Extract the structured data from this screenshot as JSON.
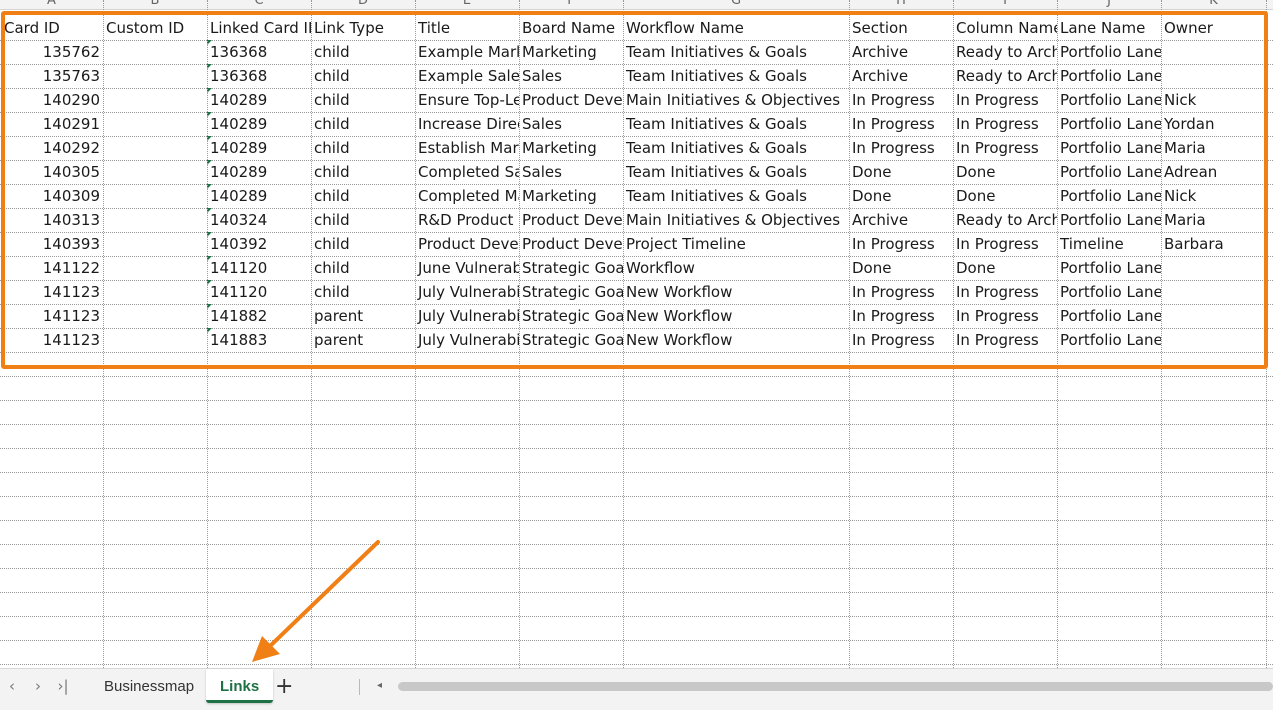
{
  "column_letters": [
    "A",
    "B",
    "C",
    "D",
    "E",
    "F",
    "G",
    "H",
    "I",
    "J",
    "K"
  ],
  "header": [
    "Card ID",
    "Custom ID",
    "Linked Card ID",
    "Link Type",
    "Title",
    "Board Name",
    "Workflow Name",
    "Section",
    "Column Name",
    "Lane Name",
    "Owner"
  ],
  "rows": [
    [
      "135762",
      "",
      "136368",
      "child",
      "Example Marketing",
      "Marketing",
      "Team Initiatives & Goals",
      "Archive",
      "Ready to Archive",
      "Portfolio Lane",
      ""
    ],
    [
      "135763",
      "",
      "136368",
      "child",
      "Example Sales",
      "Sales",
      "Team Initiatives & Goals",
      "Archive",
      "Ready to Archive",
      "Portfolio Lane",
      ""
    ],
    [
      "140290",
      "",
      "140289",
      "child",
      "Ensure Top-Level",
      "Product Development",
      "Main Initiatives & Objectives",
      "In Progress",
      "In Progress",
      "Portfolio Lane",
      "Nick"
    ],
    [
      "140291",
      "",
      "140289",
      "child",
      "Increase Direct",
      "Sales",
      "Team Initiatives & Goals",
      "In Progress",
      "In Progress",
      "Portfolio Lane",
      "Yordan"
    ],
    [
      "140292",
      "",
      "140289",
      "child",
      "Establish Market",
      "Marketing",
      "Team Initiatives & Goals",
      "In Progress",
      "In Progress",
      "Portfolio Lane",
      "Maria"
    ],
    [
      "140305",
      "",
      "140289",
      "child",
      "Completed Sales",
      "Sales",
      "Team Initiatives & Goals",
      "Done",
      "Done",
      "Portfolio Lane",
      "Adrean"
    ],
    [
      "140309",
      "",
      "140289",
      "child",
      "Completed Marketing",
      "Marketing",
      "Team Initiatives & Goals",
      "Done",
      "Done",
      "Portfolio Lane",
      "Nick"
    ],
    [
      "140313",
      "",
      "140324",
      "child",
      "R&D Product",
      "Product Development",
      "Main Initiatives & Objectives",
      "Archive",
      "Ready to Archive",
      "Portfolio Lane",
      "Maria"
    ],
    [
      "140393",
      "",
      "140392",
      "child",
      "Product Development",
      "Product Development",
      "Project Timeline",
      "In Progress",
      "In Progress",
      "Timeline",
      "Barbara"
    ],
    [
      "141122",
      "",
      "141120",
      "child",
      "June Vulnerability",
      "Strategic Goals",
      "Workflow",
      "Done",
      "Done",
      "Portfolio Lane",
      ""
    ],
    [
      "141123",
      "",
      "141120",
      "child",
      "July Vulnerability",
      "Strategic Goals",
      "New Workflow",
      "In Progress",
      "In Progress",
      "Portfolio Lane",
      ""
    ],
    [
      "141123",
      "",
      "141882",
      "parent",
      "July Vulnerability",
      "Strategic Goals",
      "New Workflow",
      "In Progress",
      "In Progress",
      "Portfolio Lane",
      ""
    ],
    [
      "141123",
      "",
      "141883",
      "parent",
      "July Vulnerability",
      "Strategic Goals",
      "New Workflow",
      "In Progress",
      "In Progress",
      "Portfolio Lane",
      ""
    ]
  ],
  "sheet_tabs": [
    "Businessmap",
    "Links"
  ],
  "active_tab": "Links",
  "add_sheet_symbol": "+",
  "nav_symbols": [
    "‹",
    "›",
    "›|"
  ],
  "scroll_left_symbol": "◂",
  "colors": {
    "highlight": "#f07f16",
    "accent_green": "#1e7145"
  }
}
